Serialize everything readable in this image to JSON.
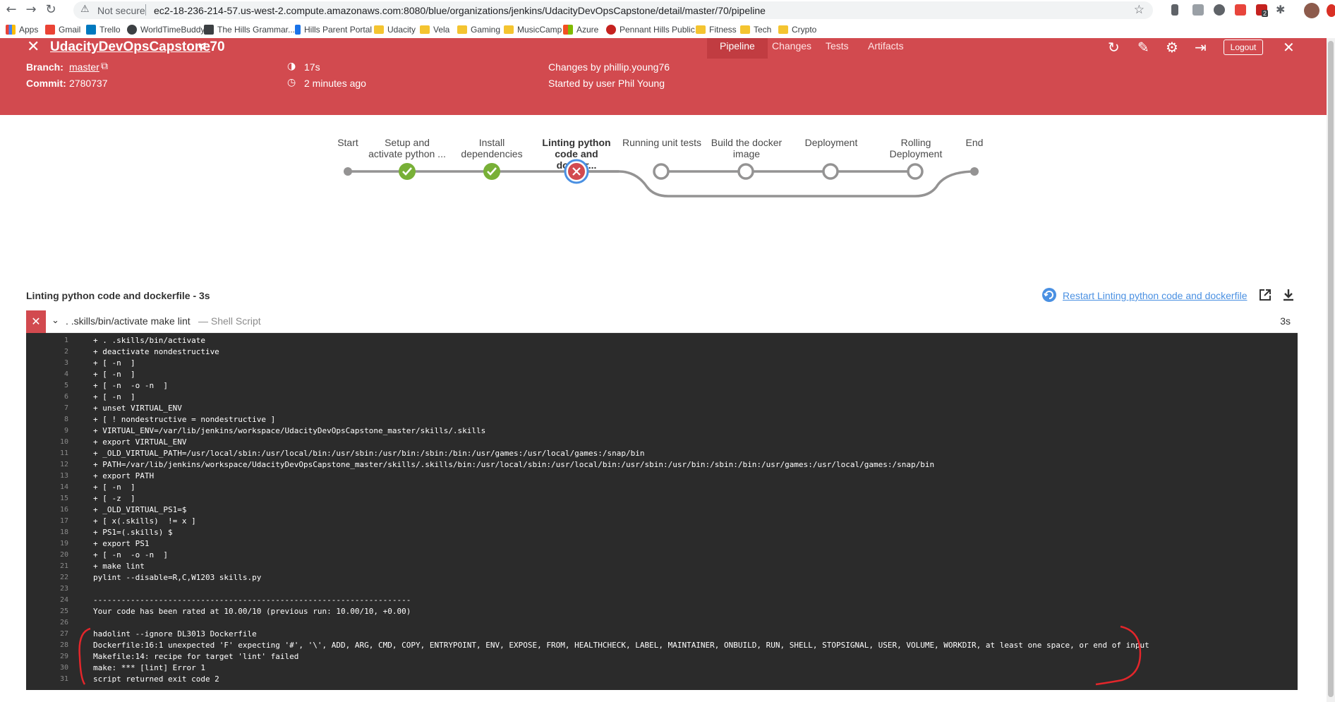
{
  "browser": {
    "security": "Not secure",
    "url": "ec2-18-236-214-57.us-west-2.compute.amazonaws.com:8080/blue/organizations/jenkins/UdacityDevOpsCapstone/detail/master/70/pipeline",
    "bookmarks": [
      "Apps",
      "Gmail",
      "Trello",
      "WorldTimeBuddy",
      "The Hills Grammar...",
      "Hills Parent Portal",
      "Udacity",
      "Vela",
      "Gaming",
      "MusicCamp",
      "Azure",
      "Pennant Hills Public...",
      "Fitness",
      "Tech",
      "Crypto"
    ],
    "extension_badge": "2"
  },
  "header": {
    "title": "UdacityDevOpsCapstone",
    "run": "< 70",
    "tabs": [
      "Pipeline",
      "Changes",
      "Tests",
      "Artifacts"
    ],
    "logout": "Logout",
    "branch_label": "Branch:",
    "branch_value": "master",
    "commit_label": "Commit:",
    "commit_value": "2780737",
    "duration": "17s",
    "time_ago": "2 minutes ago",
    "changes_by": "Changes by phillip.young76",
    "started_by": "Started by user Phil Young",
    "color": "#d24a4f"
  },
  "pipeline": {
    "stages": [
      {
        "line1": "",
        "line2": "Start",
        "status": "start"
      },
      {
        "line1": "Setup and",
        "line2": "activate python ...",
        "status": "success"
      },
      {
        "line1": "Install",
        "line2": "dependencies",
        "status": "success"
      },
      {
        "line1": "Linting python",
        "line2": "code and docker...",
        "status": "failed"
      },
      {
        "line1": "",
        "line2": "Running unit tests",
        "status": "not-run"
      },
      {
        "line1": "Build the docker",
        "line2": "image",
        "status": "not-run"
      },
      {
        "line1": "",
        "line2": "Deployment",
        "status": "not-run"
      },
      {
        "line1": "Rolling",
        "line2": "Deployment",
        "status": "not-run"
      },
      {
        "line1": "",
        "line2": "End",
        "status": "end"
      }
    ],
    "success_color": "#78b037",
    "failed_color": "#d24a4f"
  },
  "step": {
    "title": "Linting python code and dockerfile - 3s",
    "restart": "Restart Linting python code and dockerfile",
    "command": ". .skills/bin/activate make lint",
    "type": "— Shell Script",
    "duration": "3s"
  },
  "log": [
    "+ . .skills/bin/activate",
    "+ deactivate nondestructive",
    "+ [ -n  ]",
    "+ [ -n  ]",
    "+ [ -n  -o -n  ]",
    "+ [ -n  ]",
    "+ unset VIRTUAL_ENV",
    "+ [ ! nondestructive = nondestructive ]",
    "+ VIRTUAL_ENV=/var/lib/jenkins/workspace/UdacityDevOpsCapstone_master/skills/.skills",
    "+ export VIRTUAL_ENV",
    "+ _OLD_VIRTUAL_PATH=/usr/local/sbin:/usr/local/bin:/usr/sbin:/usr/bin:/sbin:/bin:/usr/games:/usr/local/games:/snap/bin",
    "+ PATH=/var/lib/jenkins/workspace/UdacityDevOpsCapstone_master/skills/.skills/bin:/usr/local/sbin:/usr/local/bin:/usr/sbin:/usr/bin:/sbin:/bin:/usr/games:/usr/local/games:/snap/bin",
    "+ export PATH",
    "+ [ -n  ]",
    "+ [ -z  ]",
    "+ _OLD_VIRTUAL_PS1=$",
    "+ [ x(.skills)  != x ]",
    "+ PS1=(.skills) $",
    "+ export PS1",
    "+ [ -n  -o -n  ]",
    "+ make lint",
    "pylint --disable=R,C,W1203 skills.py",
    "",
    "--------------------------------------------------------------------",
    "Your code has been rated at 10.00/10 (previous run: 10.00/10, +0.00)",
    "",
    "hadolint --ignore DL3013 Dockerfile",
    "Dockerfile:16:1 unexpected 'F' expecting '#', '\\', ADD, ARG, CMD, COPY, ENTRYPOINT, ENV, EXPOSE, FROM, HEALTHCHECK, LABEL, MAINTAINER, ONBUILD, RUN, SHELL, STOPSIGNAL, USER, VOLUME, WORKDIR, at least one space, or end of input",
    "Makefile:14: recipe for target 'lint' failed",
    "make: *** [lint] Error 1",
    "script returned exit code 2"
  ]
}
